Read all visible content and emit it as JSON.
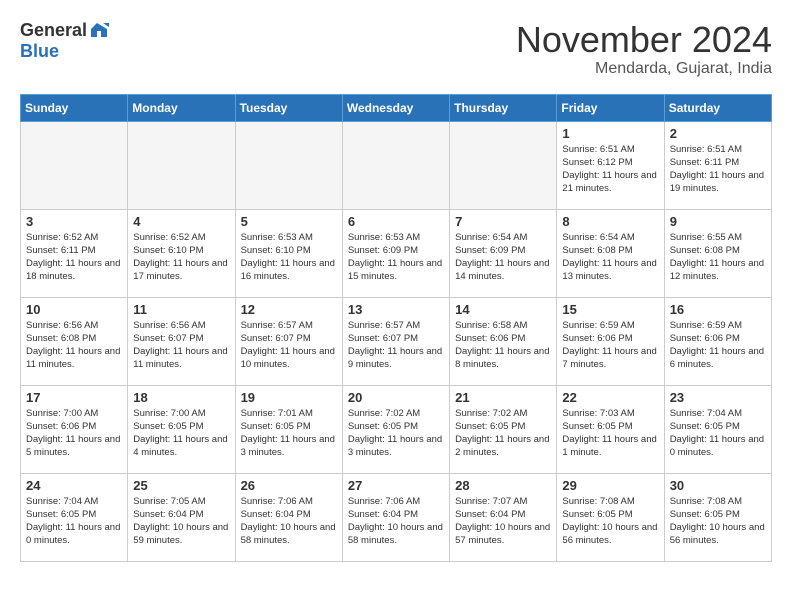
{
  "header": {
    "logo_general": "General",
    "logo_blue": "Blue",
    "month": "November 2024",
    "location": "Mendarda, Gujarat, India"
  },
  "days_of_week": [
    "Sunday",
    "Monday",
    "Tuesday",
    "Wednesday",
    "Thursday",
    "Friday",
    "Saturday"
  ],
  "weeks": [
    [
      {
        "day": "",
        "empty": true
      },
      {
        "day": "",
        "empty": true
      },
      {
        "day": "",
        "empty": true
      },
      {
        "day": "",
        "empty": true
      },
      {
        "day": "",
        "empty": true
      },
      {
        "day": "1",
        "sunrise": "Sunrise: 6:51 AM",
        "sunset": "Sunset: 6:12 PM",
        "daylight": "Daylight: 11 hours and 21 minutes."
      },
      {
        "day": "2",
        "sunrise": "Sunrise: 6:51 AM",
        "sunset": "Sunset: 6:11 PM",
        "daylight": "Daylight: 11 hours and 19 minutes."
      }
    ],
    [
      {
        "day": "3",
        "sunrise": "Sunrise: 6:52 AM",
        "sunset": "Sunset: 6:11 PM",
        "daylight": "Daylight: 11 hours and 18 minutes."
      },
      {
        "day": "4",
        "sunrise": "Sunrise: 6:52 AM",
        "sunset": "Sunset: 6:10 PM",
        "daylight": "Daylight: 11 hours and 17 minutes."
      },
      {
        "day": "5",
        "sunrise": "Sunrise: 6:53 AM",
        "sunset": "Sunset: 6:10 PM",
        "daylight": "Daylight: 11 hours and 16 minutes."
      },
      {
        "day": "6",
        "sunrise": "Sunrise: 6:53 AM",
        "sunset": "Sunset: 6:09 PM",
        "daylight": "Daylight: 11 hours and 15 minutes."
      },
      {
        "day": "7",
        "sunrise": "Sunrise: 6:54 AM",
        "sunset": "Sunset: 6:09 PM",
        "daylight": "Daylight: 11 hours and 14 minutes."
      },
      {
        "day": "8",
        "sunrise": "Sunrise: 6:54 AM",
        "sunset": "Sunset: 6:08 PM",
        "daylight": "Daylight: 11 hours and 13 minutes."
      },
      {
        "day": "9",
        "sunrise": "Sunrise: 6:55 AM",
        "sunset": "Sunset: 6:08 PM",
        "daylight": "Daylight: 11 hours and 12 minutes."
      }
    ],
    [
      {
        "day": "10",
        "sunrise": "Sunrise: 6:56 AM",
        "sunset": "Sunset: 6:08 PM",
        "daylight": "Daylight: 11 hours and 11 minutes."
      },
      {
        "day": "11",
        "sunrise": "Sunrise: 6:56 AM",
        "sunset": "Sunset: 6:07 PM",
        "daylight": "Daylight: 11 hours and 11 minutes."
      },
      {
        "day": "12",
        "sunrise": "Sunrise: 6:57 AM",
        "sunset": "Sunset: 6:07 PM",
        "daylight": "Daylight: 11 hours and 10 minutes."
      },
      {
        "day": "13",
        "sunrise": "Sunrise: 6:57 AM",
        "sunset": "Sunset: 6:07 PM",
        "daylight": "Daylight: 11 hours and 9 minutes."
      },
      {
        "day": "14",
        "sunrise": "Sunrise: 6:58 AM",
        "sunset": "Sunset: 6:06 PM",
        "daylight": "Daylight: 11 hours and 8 minutes."
      },
      {
        "day": "15",
        "sunrise": "Sunrise: 6:59 AM",
        "sunset": "Sunset: 6:06 PM",
        "daylight": "Daylight: 11 hours and 7 minutes."
      },
      {
        "day": "16",
        "sunrise": "Sunrise: 6:59 AM",
        "sunset": "Sunset: 6:06 PM",
        "daylight": "Daylight: 11 hours and 6 minutes."
      }
    ],
    [
      {
        "day": "17",
        "sunrise": "Sunrise: 7:00 AM",
        "sunset": "Sunset: 6:06 PM",
        "daylight": "Daylight: 11 hours and 5 minutes."
      },
      {
        "day": "18",
        "sunrise": "Sunrise: 7:00 AM",
        "sunset": "Sunset: 6:05 PM",
        "daylight": "Daylight: 11 hours and 4 minutes."
      },
      {
        "day": "19",
        "sunrise": "Sunrise: 7:01 AM",
        "sunset": "Sunset: 6:05 PM",
        "daylight": "Daylight: 11 hours and 3 minutes."
      },
      {
        "day": "20",
        "sunrise": "Sunrise: 7:02 AM",
        "sunset": "Sunset: 6:05 PM",
        "daylight": "Daylight: 11 hours and 3 minutes."
      },
      {
        "day": "21",
        "sunrise": "Sunrise: 7:02 AM",
        "sunset": "Sunset: 6:05 PM",
        "daylight": "Daylight: 11 hours and 2 minutes."
      },
      {
        "day": "22",
        "sunrise": "Sunrise: 7:03 AM",
        "sunset": "Sunset: 6:05 PM",
        "daylight": "Daylight: 11 hours and 1 minute."
      },
      {
        "day": "23",
        "sunrise": "Sunrise: 7:04 AM",
        "sunset": "Sunset: 6:05 PM",
        "daylight": "Daylight: 11 hours and 0 minutes."
      }
    ],
    [
      {
        "day": "24",
        "sunrise": "Sunrise: 7:04 AM",
        "sunset": "Sunset: 6:05 PM",
        "daylight": "Daylight: 11 hours and 0 minutes."
      },
      {
        "day": "25",
        "sunrise": "Sunrise: 7:05 AM",
        "sunset": "Sunset: 6:04 PM",
        "daylight": "Daylight: 10 hours and 59 minutes."
      },
      {
        "day": "26",
        "sunrise": "Sunrise: 7:06 AM",
        "sunset": "Sunset: 6:04 PM",
        "daylight": "Daylight: 10 hours and 58 minutes."
      },
      {
        "day": "27",
        "sunrise": "Sunrise: 7:06 AM",
        "sunset": "Sunset: 6:04 PM",
        "daylight": "Daylight: 10 hours and 58 minutes."
      },
      {
        "day": "28",
        "sunrise": "Sunrise: 7:07 AM",
        "sunset": "Sunset: 6:04 PM",
        "daylight": "Daylight: 10 hours and 57 minutes."
      },
      {
        "day": "29",
        "sunrise": "Sunrise: 7:08 AM",
        "sunset": "Sunset: 6:05 PM",
        "daylight": "Daylight: 10 hours and 56 minutes."
      },
      {
        "day": "30",
        "sunrise": "Sunrise: 7:08 AM",
        "sunset": "Sunset: 6:05 PM",
        "daylight": "Daylight: 10 hours and 56 minutes."
      }
    ]
  ]
}
